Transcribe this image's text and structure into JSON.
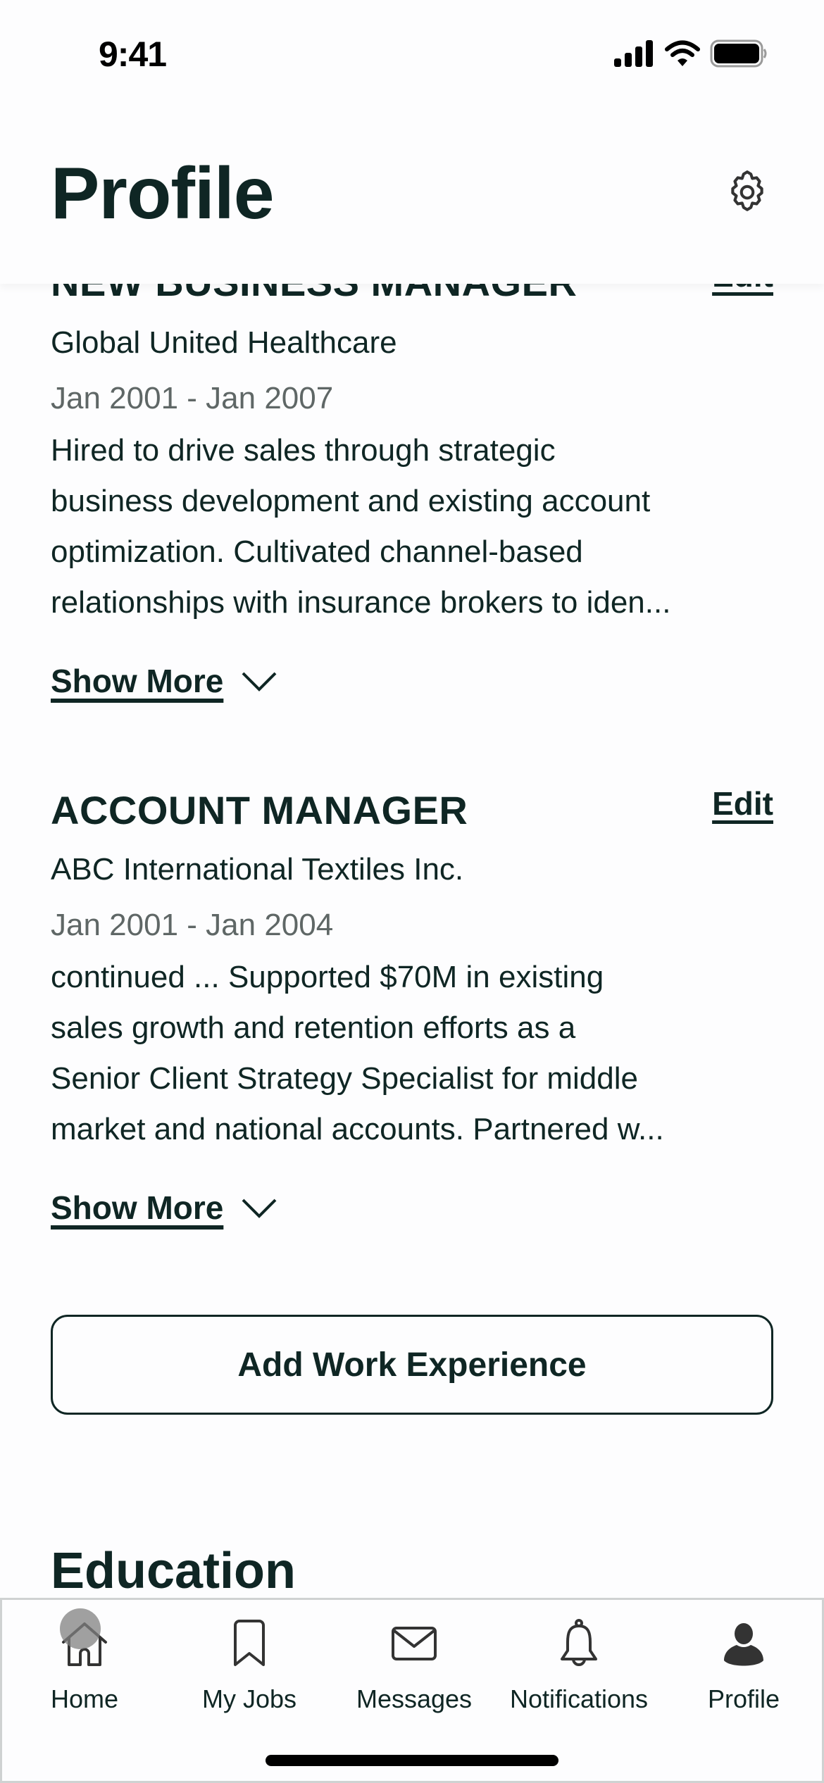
{
  "status_bar": {
    "time": "9:41",
    "icons": [
      "signal-icon",
      "wifi-icon",
      "battery-icon"
    ]
  },
  "header": {
    "title": "Profile",
    "settings_icon": "gear-icon"
  },
  "work_experience": [
    {
      "title": "NEW BUSINESS MANAGER",
      "edit_label": "Edit",
      "company": "Global United Healthcare",
      "dates": "Jan 2001 - Jan 2007",
      "description_lines": [
        "Hired to drive sales through strategic",
        "business development and existing account",
        "optimization. Cultivated channel-based",
        "relationships with insurance brokers to iden..."
      ],
      "show_more_label": "Show More"
    },
    {
      "title": "ACCOUNT MANAGER",
      "edit_label": "Edit",
      "company": "ABC International Textiles Inc.",
      "dates": "Jan 2001 - Jan 2004",
      "description_lines": [
        "continued ... Supported $70M in existing",
        "sales growth and retention efforts as a",
        "Senior Client Strategy Specialist for middle",
        "market  and national accounts. Partnered w..."
      ],
      "show_more_label": "Show More"
    }
  ],
  "add_work_experience_label": "Add Work Experience",
  "education": {
    "title": "Education"
  },
  "tab_bar": {
    "active": "Profile",
    "tabs": [
      {
        "label": "Home",
        "icon": "home-icon"
      },
      {
        "label": "My Jobs",
        "icon": "bookmark-icon"
      },
      {
        "label": "Messages",
        "icon": "envelope-icon"
      },
      {
        "label": "Notifications",
        "icon": "bell-icon"
      },
      {
        "label": "Profile",
        "icon": "person-icon"
      }
    ]
  },
  "colors": {
    "text": "#0f2624",
    "muted": "#5f6766",
    "background": "#fdfdfe",
    "icon": "#333333"
  }
}
